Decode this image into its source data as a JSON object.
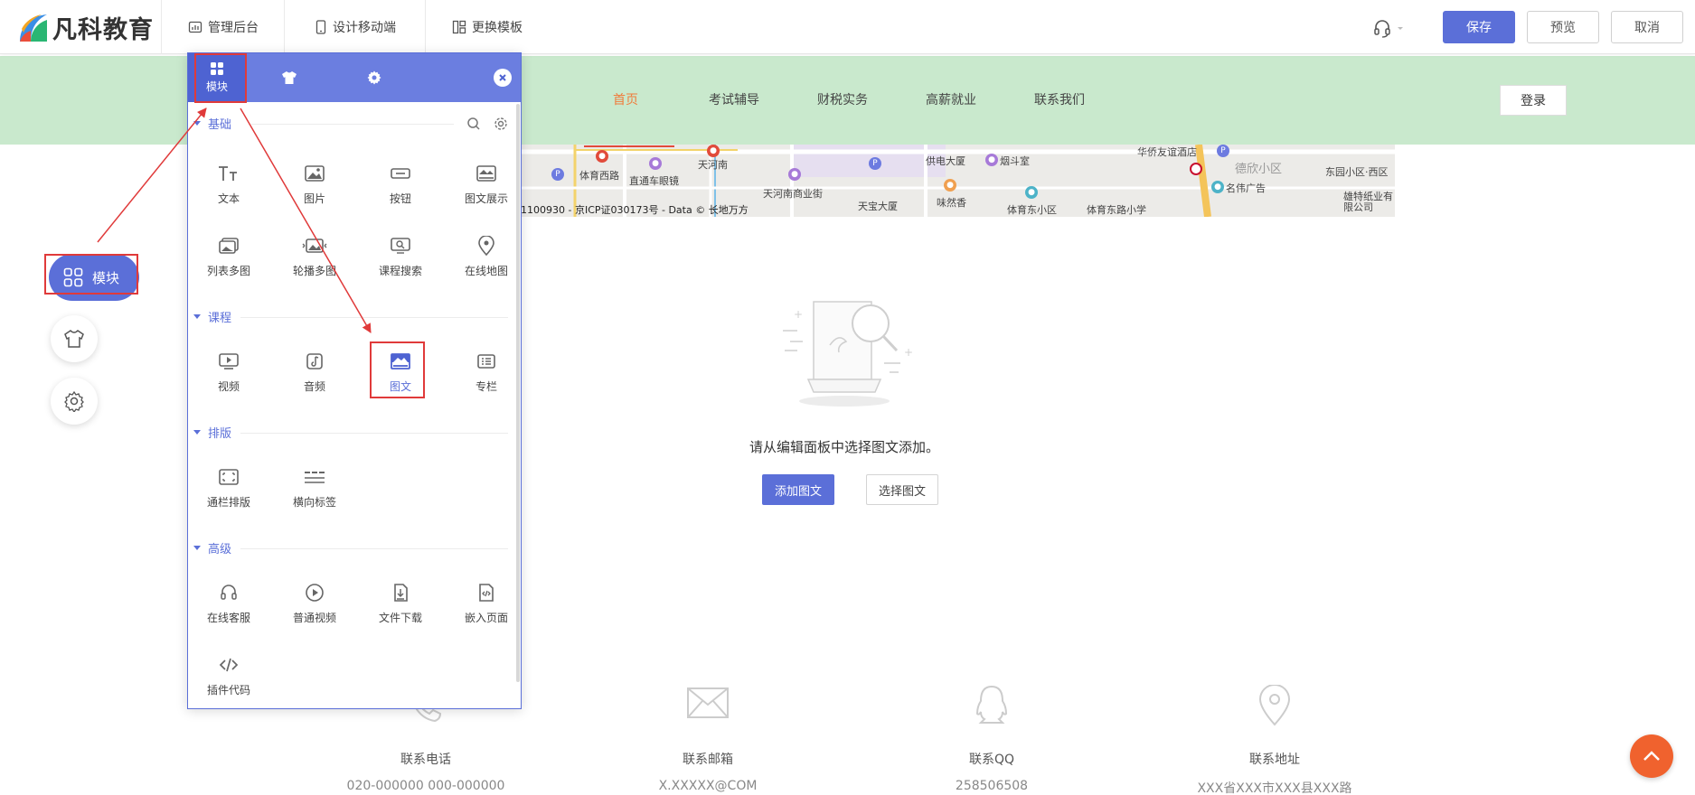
{
  "app": {
    "logo_text": "凡科教育",
    "nav": [
      {
        "label": "管理后台",
        "icon": "chart-icon"
      },
      {
        "label": "设计移动端",
        "icon": "mobile-icon"
      },
      {
        "label": "更换模板",
        "icon": "template-icon"
      }
    ],
    "buttons": {
      "save": "保存",
      "preview": "预览",
      "cancel": "取消"
    },
    "accent": "#5b6fd8"
  },
  "site": {
    "nav": [
      "首页",
      "考试辅导",
      "财税实务",
      "高薪就业",
      "联系我们"
    ],
    "active_index": 0,
    "login": "登录",
    "map": {
      "labels": [
        "体育西路",
        "直通车眼镜",
        "天河南",
        "天河南商业街",
        "天宝大厦",
        "供电大厦",
        "烟斗室",
        "味然香",
        "体育东小区",
        "体育东路小学",
        "华侨友谊酒店",
        "德欣小区",
        "名伟广告",
        "东园小区·西区",
        "雄特纸业有限公司"
      ],
      "copyright": "1100930 - 京ICP证030173号 - Data © 长地万方"
    },
    "empty": {
      "text": "请从编辑面板中选择图文添加。",
      "add": "添加图文",
      "select": "选择图文"
    },
    "contacts": [
      {
        "title": "联系电话",
        "value": "020-000000 000-000000",
        "icon": "phone-icon"
      },
      {
        "title": "联系邮箱",
        "value": "X.XXXXX@COM",
        "icon": "mail-icon"
      },
      {
        "title": "联系QQ",
        "value": "258506508",
        "icon": "qq-icon"
      },
      {
        "title": "联系地址",
        "value": "XXX省XXX市XXX县XXX路",
        "icon": "location-icon"
      }
    ]
  },
  "float": {
    "module_label": "模块"
  },
  "panel": {
    "tabs": [
      {
        "label": "模块",
        "icon": "grid-icon"
      },
      {
        "label": "",
        "icon": "shirt-icon"
      },
      {
        "label": "",
        "icon": "gear-icon"
      }
    ],
    "sections": [
      {
        "title": "基础",
        "items": [
          "文本",
          "图片",
          "按钮",
          "图文展示",
          "列表多图",
          "轮播多图",
          "课程搜索",
          "在线地图"
        ]
      },
      {
        "title": "课程",
        "items": [
          "视频",
          "音频",
          "图文",
          "专栏"
        ]
      },
      {
        "title": "排版",
        "items": [
          "通栏排版",
          "横向标签"
        ]
      },
      {
        "title": "高级",
        "items": [
          "在线客服",
          "普通视频",
          "文件下载",
          "嵌入页面",
          "插件代码"
        ]
      }
    ]
  }
}
